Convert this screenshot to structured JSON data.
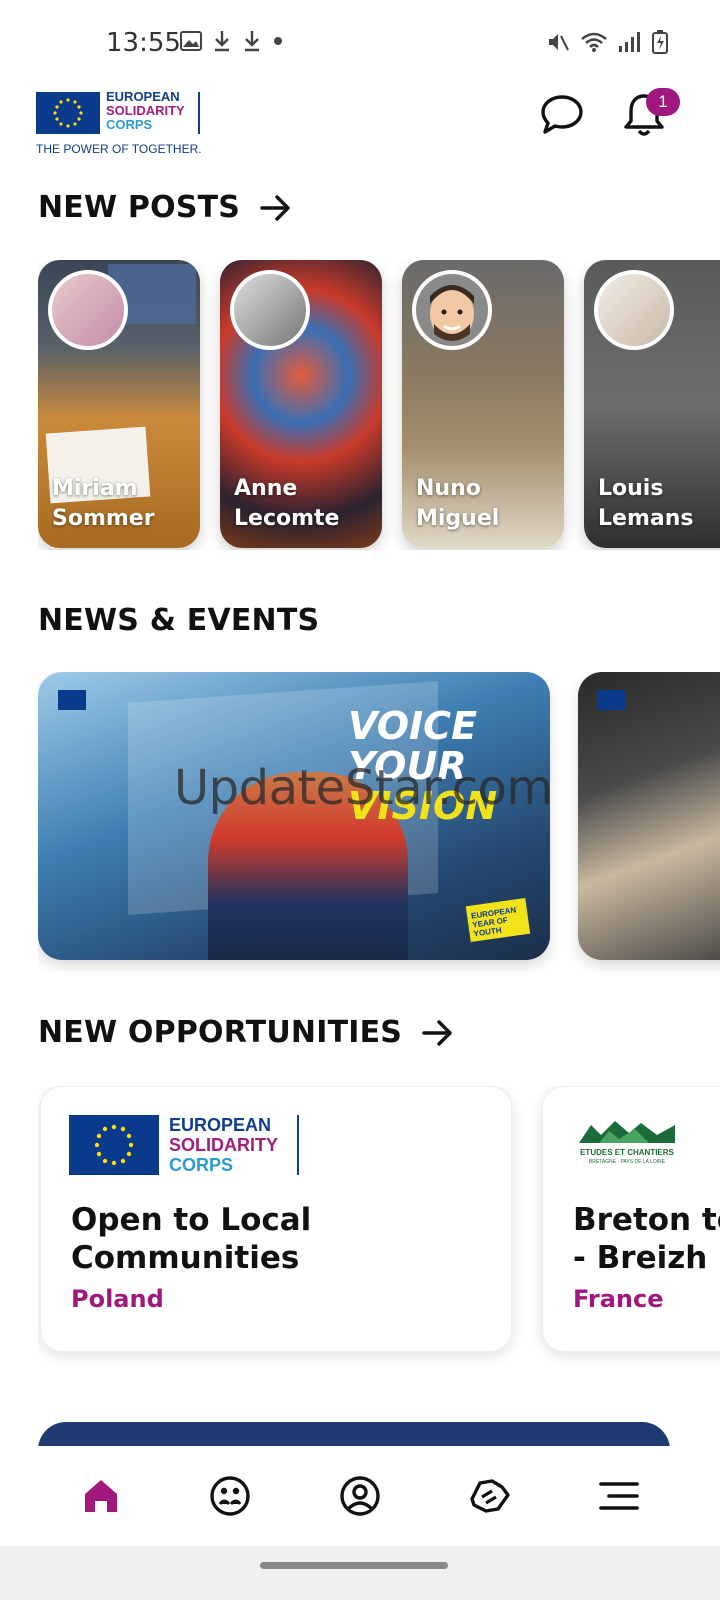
{
  "status_bar": {
    "time": "13:55",
    "left_icons": [
      "image-icon",
      "download-icon",
      "download-icon",
      "dot-icon"
    ],
    "right_icons": [
      "mute-icon",
      "wifi-icon",
      "signal-icon",
      "battery-icon"
    ]
  },
  "header": {
    "logo": {
      "line1": "EUROPEAN",
      "line2": "SOLIDARITY",
      "line3": "CORPS",
      "tagline": "THE POWER OF TOGETHER."
    },
    "notifications_count": "1",
    "chat_icon": "chat-bubble-icon",
    "bell_icon": "bell-icon"
  },
  "sections": {
    "new_posts": "NEW POSTS",
    "news_events": "NEWS & EVENTS",
    "new_opportunities": "NEW OPPORTUNITIES"
  },
  "posts": [
    {
      "name": "Miriam Sommer"
    },
    {
      "name": "Anne Lecomte"
    },
    {
      "name": "Nuno Miguel"
    },
    {
      "name": "Louis Lemans"
    }
  ],
  "news": [
    {
      "headline_1": "VOICE",
      "headline_2": "YOUR",
      "headline_3": "VISION",
      "tag": "EUROPEAN YEAR OF YOUTH"
    },
    {
      "headline_1": "",
      "headline_2": "",
      "headline_3": "",
      "tag": ""
    }
  ],
  "watermark": "UpdateStar.com",
  "opportunities": [
    {
      "title": "Open to Local\nCommunities",
      "country": "Poland",
      "org_line1": "EUROPEAN",
      "org_line2": "SOLIDARITY",
      "org_line3": "CORPS"
    },
    {
      "title": "Breton te\n- Breizh",
      "country": "France",
      "org_line1": "ETUDES ET CHANTIERS",
      "org_line2": "BRETAGNE · PAYS DE LA LOIRE",
      "org_line3": ""
    }
  ],
  "bottom_nav": [
    {
      "icon": "home-icon",
      "active": true
    },
    {
      "icon": "community-icon",
      "active": false
    },
    {
      "icon": "profile-icon",
      "active": false
    },
    {
      "icon": "handshake-icon",
      "active": false
    },
    {
      "icon": "menu-icon",
      "active": false
    }
  ],
  "colors": {
    "accent": "#a0187e",
    "brand_blue": "#0f3d8f",
    "banner": "#1e3a70"
  }
}
